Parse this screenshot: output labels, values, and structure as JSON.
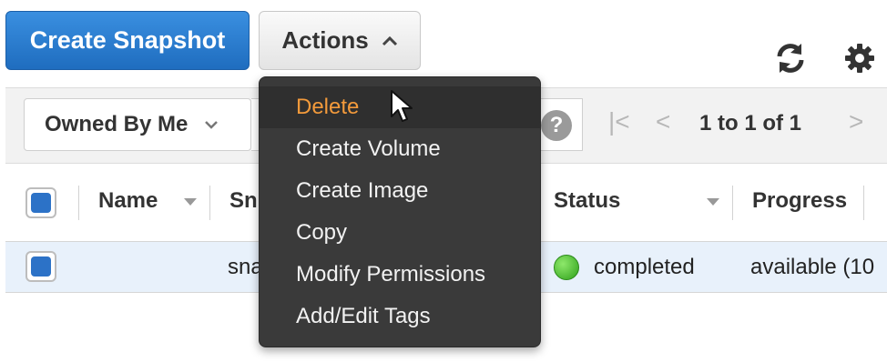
{
  "toolbar": {
    "create_label": "Create Snapshot",
    "actions_label": "Actions",
    "refresh_icon": "refresh-icon",
    "settings_icon": "gear-icon"
  },
  "filter": {
    "owner_selected": "Owned By Me",
    "search_value": "",
    "pagination": "1 to 1 of 1"
  },
  "table": {
    "columns": [
      "Name",
      "Sn",
      "Status",
      "Progress"
    ],
    "rows": [
      {
        "name": "",
        "snapshot_id": "sna",
        "status": "completed",
        "progress": "available (10"
      }
    ]
  },
  "actions_menu": {
    "items": [
      "Delete",
      "Create Volume",
      "Create Image",
      "Copy",
      "Modify Permissions",
      "Add/Edit Tags"
    ],
    "hovered": "Delete"
  },
  "colors": {
    "primary": "#2c7bd4",
    "hover_text": "#f39a3b",
    "status_ok": "#3fb820"
  }
}
